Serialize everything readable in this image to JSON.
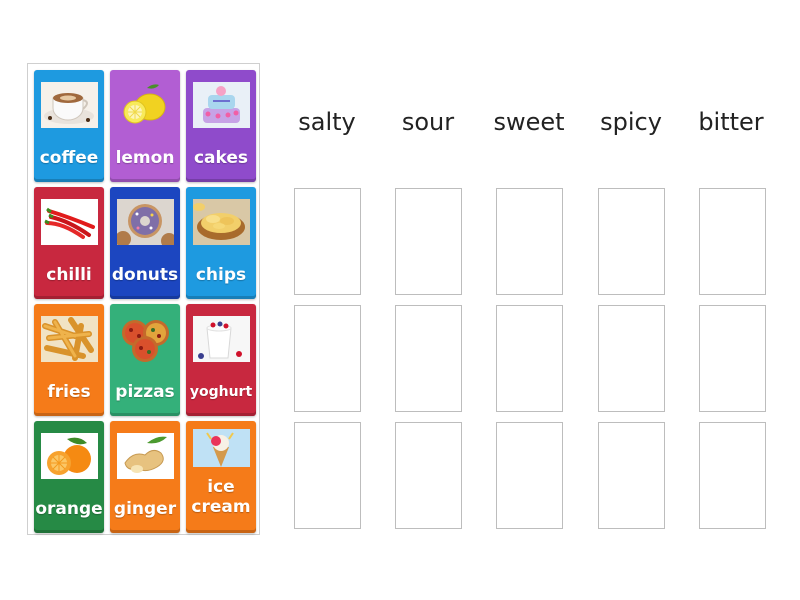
{
  "cards": [
    {
      "label": "coffee",
      "color": "#1e9ae0",
      "icon": "coffee-cup-image"
    },
    {
      "label": "lemon",
      "color": "#b25ed3",
      "icon": "lemon-image"
    },
    {
      "label": "cakes",
      "color": "#8f4bcb",
      "icon": "cake-image"
    },
    {
      "label": "chilli",
      "color": "#c8283f",
      "icon": "chilli-image"
    },
    {
      "label": "donuts",
      "color": "#1c46c0",
      "icon": "donut-image"
    },
    {
      "label": "chips",
      "color": "#1e9ae0",
      "icon": "chips-image"
    },
    {
      "label": "fries",
      "color": "#f57b19",
      "icon": "fries-image"
    },
    {
      "label": "pizzas",
      "color": "#34b07a",
      "icon": "pizza-image"
    },
    {
      "label": "yoghurt",
      "color": "#c8283f",
      "icon": "yoghurt-image"
    },
    {
      "label": "orange",
      "color": "#268a45",
      "icon": "orange-image"
    },
    {
      "label": "ginger",
      "color": "#f57b19",
      "icon": "ginger-image"
    },
    {
      "label": "ice cream",
      "color": "#f57b19",
      "icon": "ice-cream-image"
    }
  ],
  "columns": [
    "salty",
    "sour",
    "sweet",
    "spicy",
    "bitter"
  ]
}
